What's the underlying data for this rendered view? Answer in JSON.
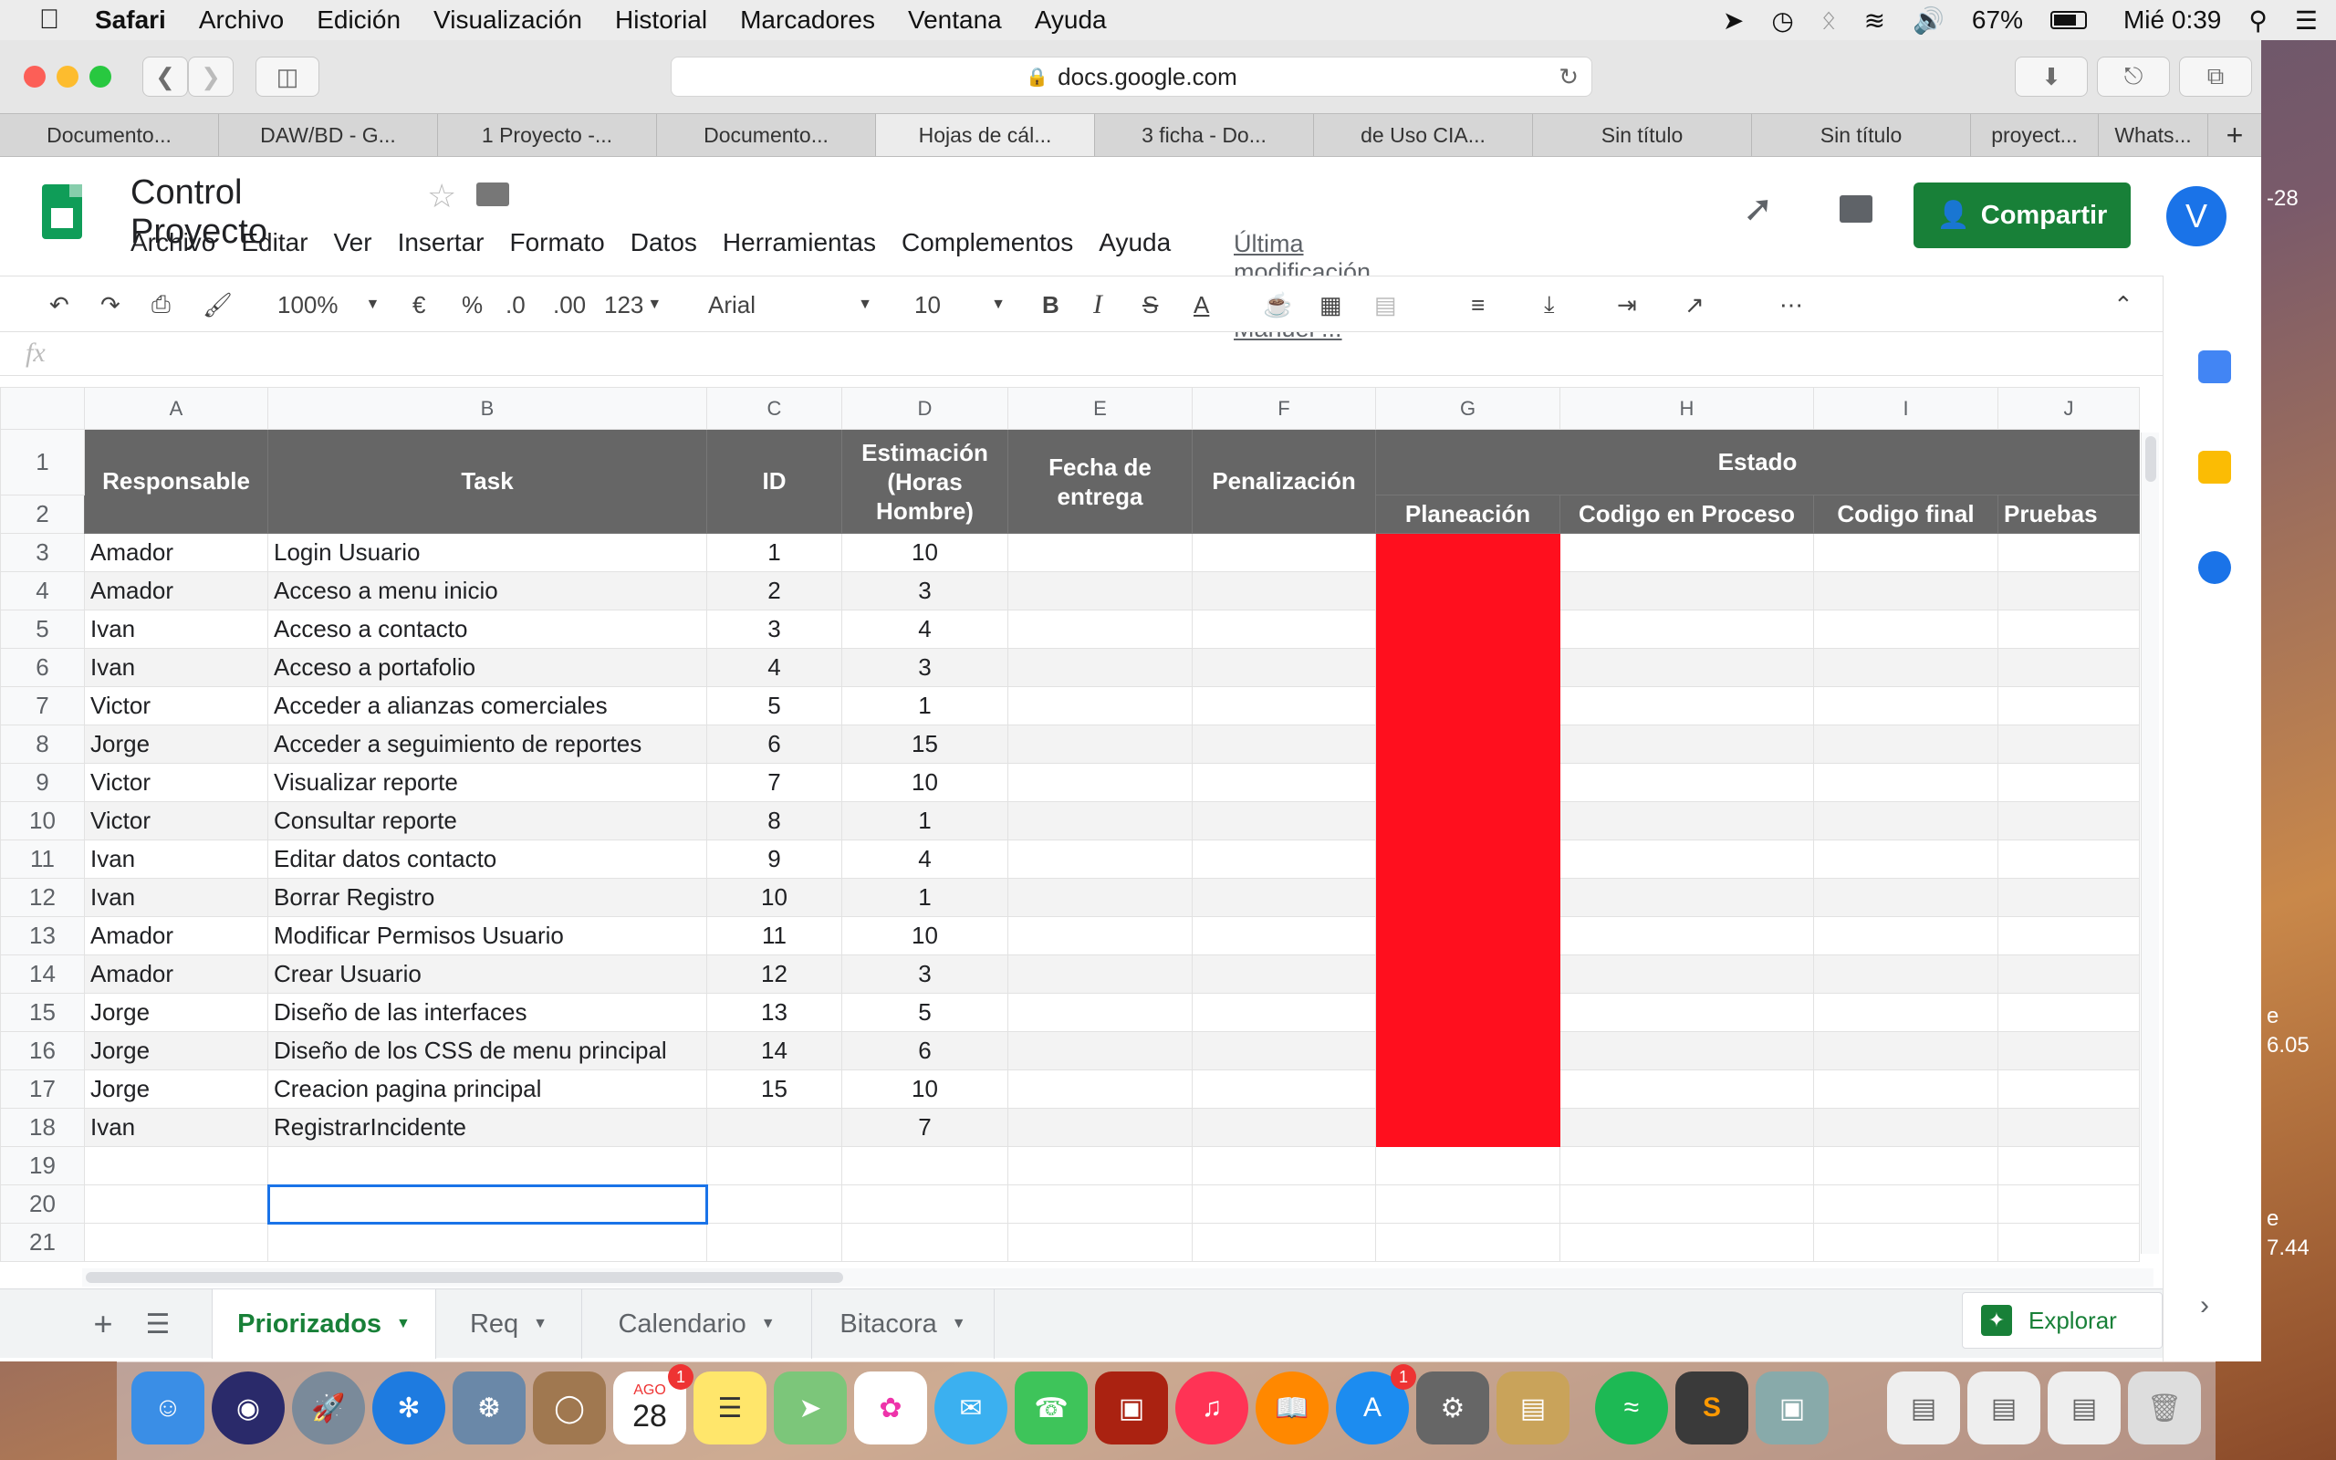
{
  "menubar": {
    "app": "Safari",
    "items": [
      "Archivo",
      "Edición",
      "Visualización",
      "Historial",
      "Marcadores",
      "Ventana",
      "Ayuda"
    ],
    "battery": "67%",
    "clock": "Mié 0:39"
  },
  "browser": {
    "url": "docs.google.com",
    "tabs": [
      "Documento...",
      "DAW/BD - G...",
      "1 Proyecto -...",
      "Documento...",
      "Hojas de cál...",
      "3 ficha - Do...",
      "de Uso CIA...",
      "Sin título",
      "Sin título",
      "proyect...",
      "Whats..."
    ],
    "active_tab": 4
  },
  "doc": {
    "title": "Control Proyecto",
    "menus": [
      "Archivo",
      "Editar",
      "Ver",
      "Insertar",
      "Formato",
      "Datos",
      "Herramientas",
      "Complementos",
      "Ayuda"
    ],
    "last_modified": "Última modificación de Juan Manuel ...",
    "share_label": "Compartir",
    "avatar": "V"
  },
  "format_toolbar": {
    "zoom": "100%",
    "currency": "€",
    "percent": "%",
    "dec_less": ".0",
    "dec_more": ".00",
    "more_formats": "123",
    "font": "Arial",
    "font_size": "10"
  },
  "formula_bar": {
    "fx": "fx"
  },
  "sheet": {
    "columns": [
      "A",
      "B",
      "C",
      "D",
      "E",
      "F",
      "G",
      "H",
      "I",
      "J"
    ],
    "header": {
      "responsable": "Responsable",
      "task": "Task",
      "id": "ID",
      "estimacion": "Estimación (Horas Hombre)",
      "fecha": "Fecha de entrega",
      "penalizacion": "Penalización",
      "estado": "Estado",
      "planeacion": "Planeación",
      "codigo_proceso": "Codigo en Proceso",
      "codigo_final": "Codigo final",
      "pruebas": "Pruebas"
    },
    "rows": [
      {
        "n": "3",
        "resp": "Amador",
        "task": "Login Usuario",
        "id": "1",
        "est": "10"
      },
      {
        "n": "4",
        "resp": "Amador",
        "task": "Acceso a menu inicio",
        "id": "2",
        "est": "3"
      },
      {
        "n": "5",
        "resp": "Ivan",
        "task": "Acceso a contacto",
        "id": "3",
        "est": "4"
      },
      {
        "n": "6",
        "resp": "Ivan",
        "task": "Acceso a portafolio",
        "id": "4",
        "est": "3"
      },
      {
        "n": "7",
        "resp": "Victor",
        "task": "Acceder a alianzas comerciales",
        "id": "5",
        "est": "1"
      },
      {
        "n": "8",
        "resp": "Jorge",
        "task": "Acceder a seguimiento de reportes",
        "id": "6",
        "est": "15"
      },
      {
        "n": "9",
        "resp": "Victor",
        "task": "Visualizar reporte",
        "id": "7",
        "est": "10"
      },
      {
        "n": "10",
        "resp": "Victor",
        "task": "Consultar reporte",
        "id": "8",
        "est": "1"
      },
      {
        "n": "11",
        "resp": "Ivan",
        "task": "Editar datos contacto",
        "id": "9",
        "est": "4"
      },
      {
        "n": "12",
        "resp": "Ivan",
        "task": "Borrar Registro",
        "id": "10",
        "est": "1"
      },
      {
        "n": "13",
        "resp": "Amador",
        "task": "Modificar Permisos Usuario",
        "id": "11",
        "est": "10"
      },
      {
        "n": "14",
        "resp": "Amador",
        "task": "Crear Usuario",
        "id": "12",
        "est": "3"
      },
      {
        "n": "15",
        "resp": "Jorge",
        "task": "Diseño de las interfaces",
        "id": "13",
        "est": "5"
      },
      {
        "n": "16",
        "resp": "Jorge",
        "task": "Diseño de los CSS de menu principal",
        "id": "14",
        "est": "6"
      },
      {
        "n": "17",
        "resp": "Jorge",
        "task": "Creacion pagina principal",
        "id": "15",
        "est": "10"
      },
      {
        "n": "18",
        "resp": "Ivan",
        "task": "RegistrarIncidente",
        "id": "",
        "est": "7"
      }
    ],
    "empty_rows": [
      "19",
      "20",
      "21"
    ],
    "status_color": "#ff0f1e"
  },
  "sheet_tabs": {
    "tabs": [
      "Priorizados",
      "Req",
      "Calendario",
      "Bitacora"
    ],
    "active": 0,
    "explore": "Explorar"
  },
  "dock": {
    "calendar_month": "AGO",
    "calendar_day": "28",
    "badge": "1"
  },
  "desktop_fragments": [
    "-28",
    "e",
    "6.05",
    "e",
    "7.44"
  ]
}
